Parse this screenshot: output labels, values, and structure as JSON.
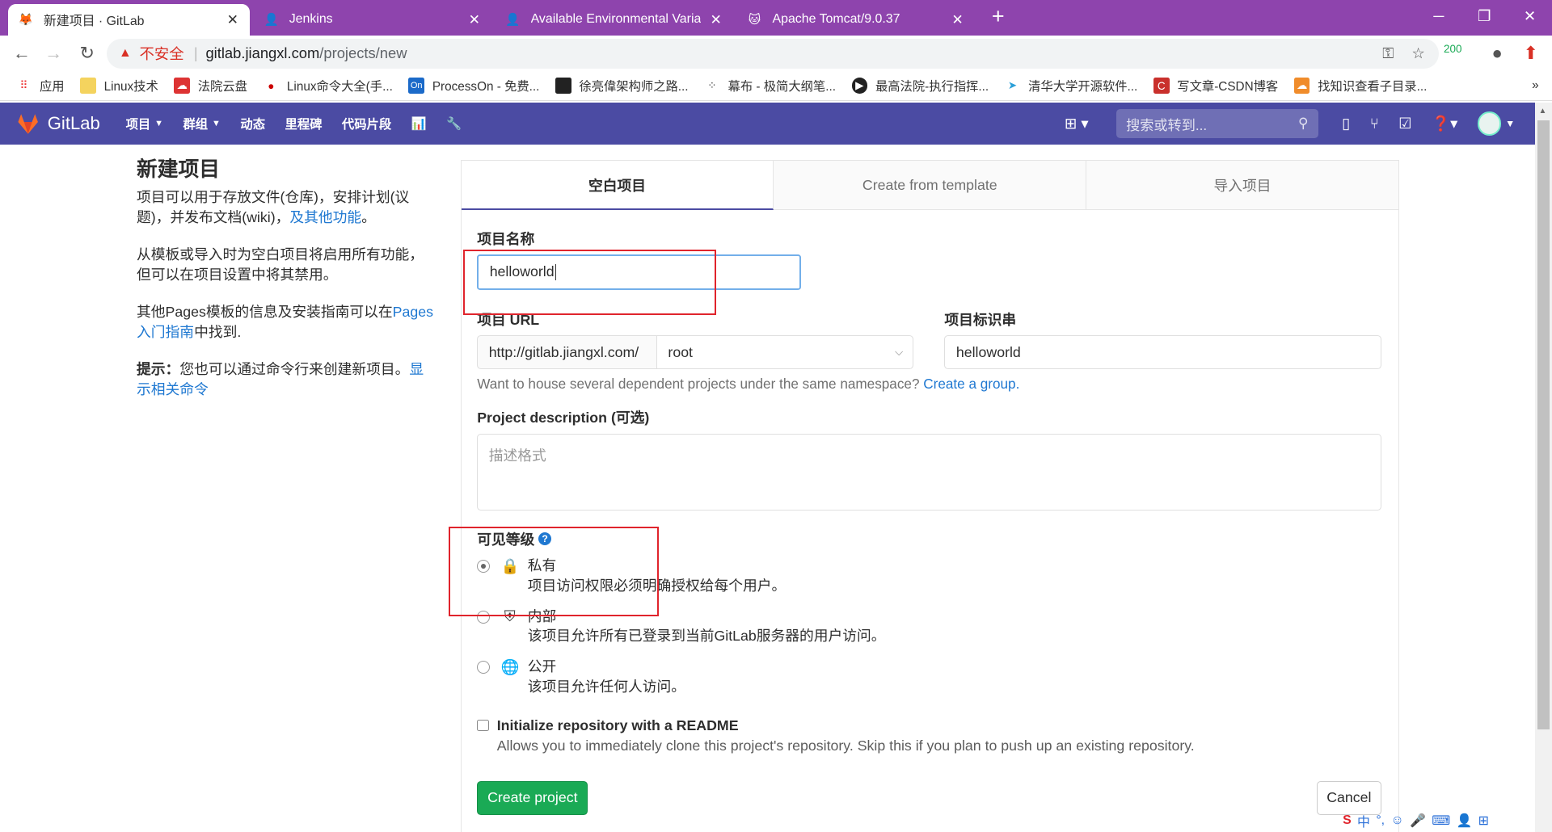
{
  "browser": {
    "tabs": [
      {
        "title": "新建项目 · GitLab",
        "icon": "gitlab-icon"
      },
      {
        "title": "Jenkins",
        "icon": "jenkins-icon"
      },
      {
        "title": "Available Environmental Variab",
        "icon": "jenkins-icon"
      },
      {
        "title": "Apache Tomcat/9.0.37",
        "icon": "tomcat-icon"
      }
    ],
    "insecure_label": "不安全",
    "url_host": "gitlab.jiangxl.com",
    "url_path": "/projects/new",
    "extension_badge": "200",
    "bookmarks": [
      "应用",
      "Linux技术",
      "法院云盘",
      "Linux命令大全(手...",
      "ProcessOn - 免费...",
      "徐亮偉架构师之路...",
      "幕布 - 极简大纲笔...",
      "最高法院-执行指挥...",
      "清华大学开源软件...",
      "写文章-CSDN博客",
      "找知识查看子目录..."
    ],
    "bookmarks_overflow": "»"
  },
  "gitlab": {
    "logo_text": "GitLab",
    "menu": [
      "项目",
      "群组",
      "动态",
      "里程碑",
      "代码片段"
    ],
    "search_placeholder": "搜索或转到..."
  },
  "intro": {
    "title": "新建项目",
    "p1_text": "项目可以用于存放文件(仓库)，安排计划(议题)，并发布文档(wiki)，",
    "p1_link": "及其他功能",
    "p1_end": "。",
    "p2": "从模板或导入时为空白项目将启用所有功能，但可以在项目设置中将其禁用。",
    "p3_text": "其他Pages模板的信息及安装指南可以在",
    "p3_link": "Pages入门指南",
    "p3_end": "中找到.",
    "tip_label": "提示：",
    "tip_text": "您也可以通过命令行来创建新项目。",
    "tip_link": "显示相关命令"
  },
  "form": {
    "tabs": [
      "空白项目",
      "Create from template",
      "导入项目"
    ],
    "name_label": "项目名称",
    "name_value": "helloworld",
    "url_label": "项目 URL",
    "url_prefix": "http://gitlab.jiangxl.com/",
    "namespace": "root",
    "slug_label": "项目标识串",
    "slug_value": "helloworld",
    "group_hint": "Want to house several dependent projects under the same namespace?",
    "group_link": "Create a group.",
    "desc_label": "Project description",
    "desc_optional": "(可选)",
    "desc_placeholder": "描述格式",
    "visibility_label": "可见等级",
    "visibility": [
      {
        "title": "私有",
        "desc": "项目访问权限必须明确授权给每个用户。",
        "icon": "lock-icon",
        "selected": true
      },
      {
        "title": "内部",
        "desc": "该项目允许所有已登录到当前GitLab服务器的用户访问。",
        "icon": "shield-icon",
        "selected": false
      },
      {
        "title": "公开",
        "desc": "该项目允许任何人访问。",
        "icon": "globe-icon",
        "selected": false
      }
    ],
    "readme_label": "Initialize repository with a README",
    "readme_desc": "Allows you to immediately clone this project's repository. Skip this if you plan to push up an existing repository.",
    "create_button": "Create project",
    "cancel_button": "Cancel"
  },
  "ime": {
    "mode": "中"
  },
  "colors": {
    "tabstrip": "#8e44ad",
    "gitlab_nav": "#4b4ba3",
    "accent": "#1f78d1",
    "create": "#1aaa55",
    "annotation": "#e0242c"
  }
}
